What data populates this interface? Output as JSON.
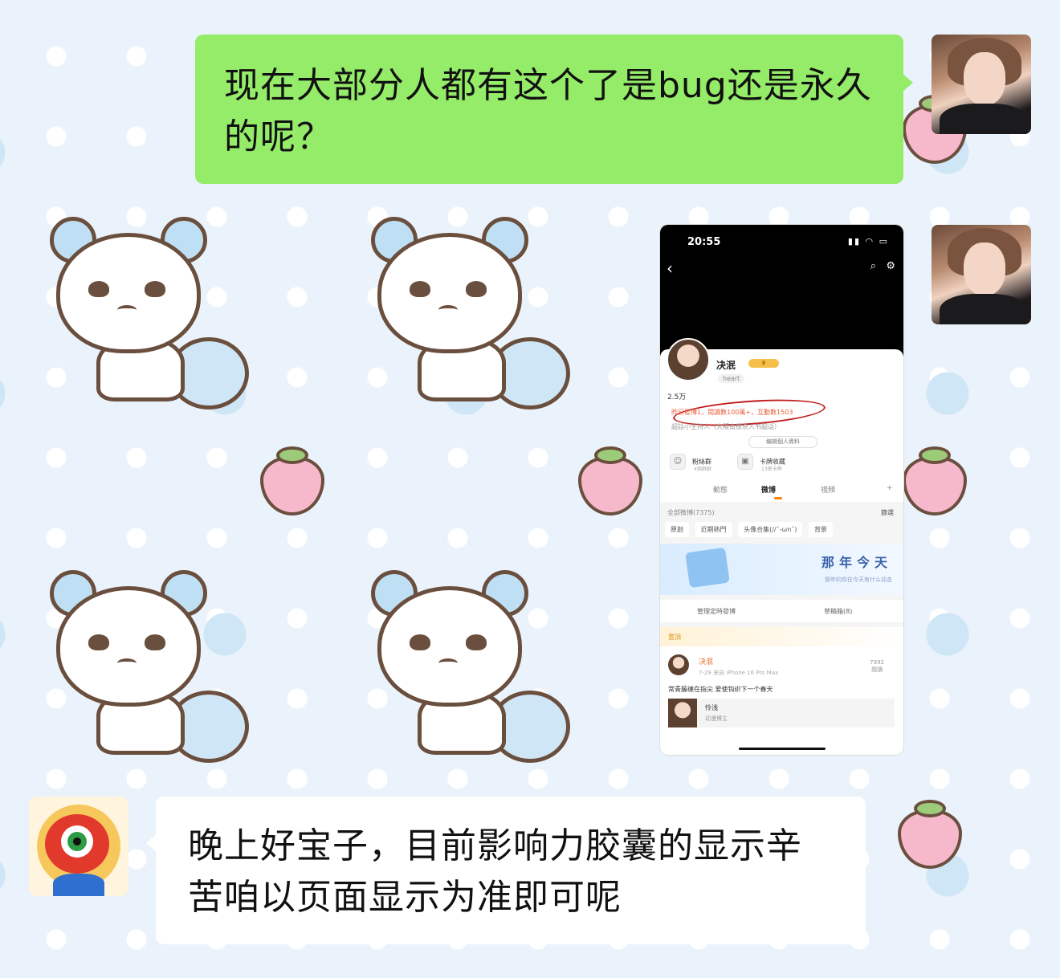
{
  "messages": {
    "sent_text": "现在大部分人都有这个了是bug还是永久的呢？",
    "reply_text": "晚上好宝子，目前影响力胶囊的显示辛苦咱以页面显示为准即可呢"
  },
  "phone": {
    "status_time": "20:55",
    "profile": {
      "name": "决泯",
      "tag": "heart",
      "stats_prefix": "2.5万",
      "influence_line": "昨日發博1，閱讀數100萬+，互動數1503",
      "super_topic_line": "超話小主持人（大阪南夜杀人书超话）",
      "edit_button": "编辑個人資料",
      "quick_fans_title": "粉絲群",
      "quick_fans_sub": "4個群聊",
      "quick_card_title": "卡牌收藏",
      "quick_card_sub": "13張卡牌"
    },
    "tabs": {
      "tab_dynamic": "動態",
      "tab_weibo": "微博",
      "tab_video": "視頻",
      "tab_add": "+"
    },
    "list": {
      "all_label": "全部微博(7375)",
      "filter_label": "篩選",
      "chip_original": "原創",
      "chip_hot": "近期熱門",
      "chip_avatar": "头像合集(//ˆ-ωnˆ)",
      "chip_bg": "背景"
    },
    "banner": {
      "title": "那年今天",
      "subtitle": "那年的你在今天有什么动态"
    },
    "manage": {
      "scheduled": "管理定時發博",
      "drafts": "草稿箱(8)"
    },
    "pinned": {
      "pin_label": "置頂",
      "author": "决泯",
      "meta": "7-29  来自 iPhone 16 Pro Max",
      "count": "7992",
      "count_sub": "閱讀",
      "text": "常青藤缠在指尖 爱使钩织下一个春天",
      "quote_name": "怜浅",
      "quote_sub": "动漫博主"
    }
  }
}
